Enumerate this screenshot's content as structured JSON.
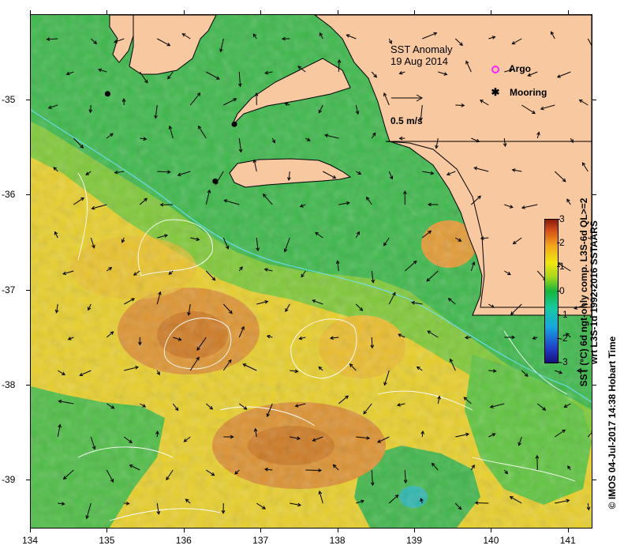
{
  "map": {
    "title": "SST Anomaly",
    "date": "19 Aug 2014",
    "x_ticks": [
      "134",
      "135",
      "136",
      "137",
      "138",
      "139",
      "140",
      "141"
    ],
    "y_ticks": [
      "-35",
      "-36",
      "-37",
      "-38",
      "-39"
    ],
    "lon_range": [
      134,
      141.3
    ],
    "lat_range": [
      -34.1,
      -39.5
    ]
  },
  "legend": {
    "argo_label": "Argo",
    "mooring_label": "Mooring",
    "vector_scale_label": "0.5 m/s"
  },
  "colorbar": {
    "ticks": [
      "3",
      "2",
      "1",
      "0",
      "-1",
      "-2",
      "-3"
    ],
    "title_line1": "SST (°C) 6d ngt-only comp. L3S-6d QL>=2",
    "title_line2": "wrt L3S-1d 1992-2016 SSTAARS"
  },
  "credit": "© IMOS 04-Jul-2017 14:38 Hobart Time",
  "colors": {
    "land": "#f8c9a0",
    "warm_anomaly": "#e2a030",
    "cool_anomaly": "#3cb84a",
    "mooring": "#000000",
    "argo": "#ff22ff"
  },
  "moorings": [
    {
      "lon": 135.0,
      "lat": -34.93
    },
    {
      "lon": 136.65,
      "lat": -35.25
    },
    {
      "lon": 136.4,
      "lat": -35.85
    }
  ]
}
